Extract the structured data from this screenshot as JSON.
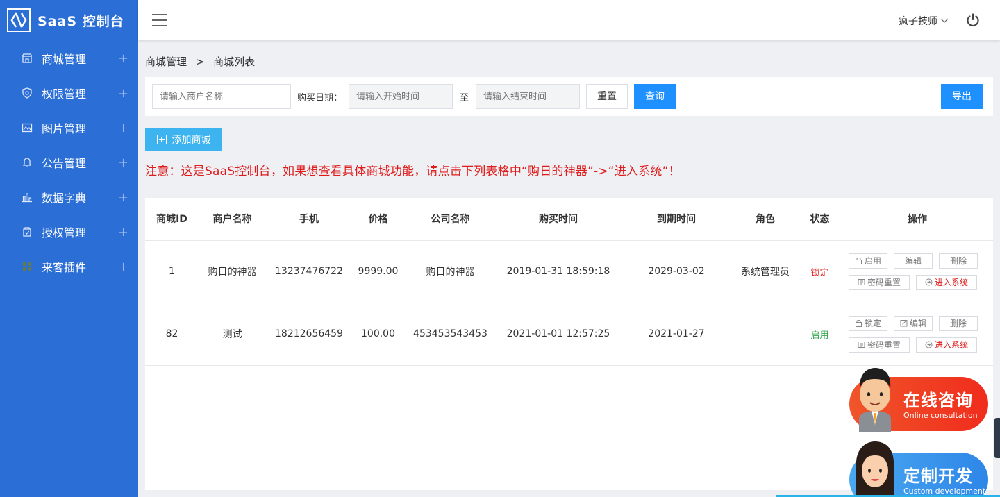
{
  "app": {
    "title": "SaaS 控制台"
  },
  "sidebar": {
    "items": [
      {
        "label": "商城管理",
        "icon": "store-icon"
      },
      {
        "label": "权限管理",
        "icon": "shield-icon"
      },
      {
        "label": "图片管理",
        "icon": "image-icon"
      },
      {
        "label": "公告管理",
        "icon": "bell-icon"
      },
      {
        "label": "数据字典",
        "icon": "chart-icon"
      },
      {
        "label": "授权管理",
        "icon": "license-icon"
      },
      {
        "label": "来客插件",
        "icon": "plugin-icon"
      }
    ],
    "expand_symbol": "+"
  },
  "header": {
    "user_name": "疯子技师"
  },
  "breadcrumb": {
    "parent": "商城管理",
    "separator": ">",
    "current": "商城列表"
  },
  "filter": {
    "merchant_placeholder": "请输入商户名称",
    "date_label": "购买日期：",
    "start_placeholder": "请输入开始时间",
    "to_label": "至",
    "end_placeholder": "请输入结束时间",
    "reset_label": "重置",
    "query_label": "查询",
    "export_label": "导出"
  },
  "add_button": {
    "label": "添加商城"
  },
  "notice": {
    "text": "注意：这是SaaS控制台，如果想查看具体商城功能，请点击下列表格中“购日的神器”->“进入系统”！"
  },
  "table": {
    "headers": [
      "商城ID",
      "商户名称",
      "手机",
      "价格",
      "公司名称",
      "购买时间",
      "到期时间",
      "角色",
      "状态",
      "操作"
    ],
    "rows": [
      {
        "id": "1",
        "merchant": "购日的神器",
        "phone": "13237476722",
        "price": "9999.00",
        "company": "购日的神器",
        "buy_time": "2019-01-31 18:59:18",
        "expire": "2029-03-02",
        "role": "系统管理员",
        "status": "锁定",
        "ops": {
          "toggle": "启用",
          "edit": "编辑",
          "delete": "删除",
          "reset_pwd": "密码重置",
          "enter": "进入系统"
        }
      },
      {
        "id": "82",
        "merchant": "测试",
        "phone": "18212656459",
        "price": "100.00",
        "company": "453453543453",
        "buy_time": "2021-01-01 12:57:25",
        "expire": "2021-01-27",
        "role": "",
        "status": "启用",
        "ops": {
          "toggle": "锁定",
          "edit": "编辑",
          "delete": "删除",
          "reset_pwd": "密码重置",
          "enter": "进入系统"
        }
      }
    ]
  },
  "float_widgets": {
    "consult": {
      "title": "在线咨询",
      "subtitle": "Online consultation"
    },
    "custom": {
      "title": "定制开发",
      "subtitle": "Custom development"
    }
  },
  "colors": {
    "sidebar_bg": "#2a6ed6",
    "primary": "#1e90ff",
    "add_button": "#3db4ef",
    "notice": "#e01b1b",
    "status_locked": "#e01b1b",
    "status_enabled": "#34a853"
  }
}
